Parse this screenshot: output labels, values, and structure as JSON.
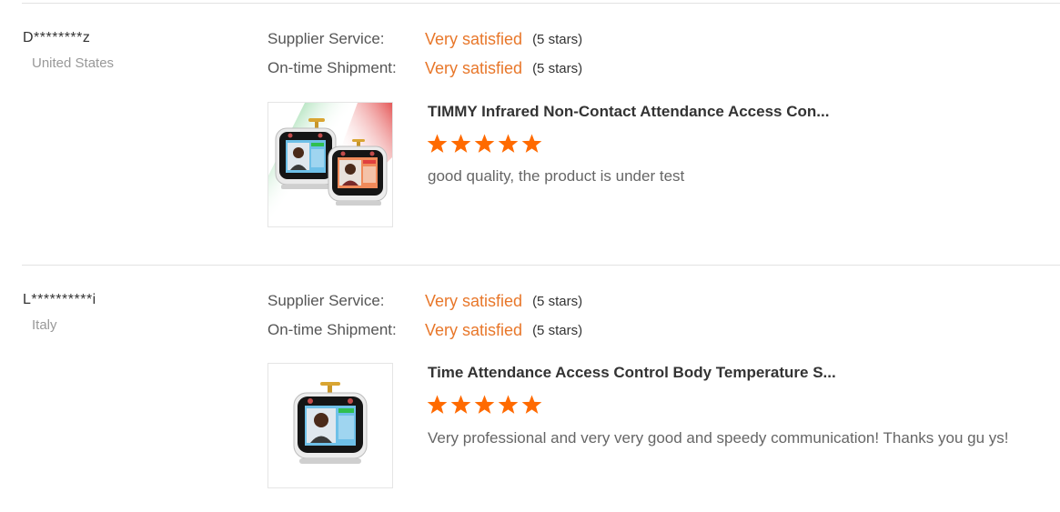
{
  "reviews": [
    {
      "buyer_name": "D********z",
      "buyer_country": "United States",
      "supplier_service": {
        "label": "Supplier Service:",
        "value": "Very satisfied",
        "stars_text": "(5 stars)"
      },
      "ontime_shipment": {
        "label": "On-time Shipment:",
        "value": "Very satisfied",
        "stars_text": "(5 stars)"
      },
      "product_title": "TIMMY Infrared Non-Contact Attendance Access Con...",
      "rating": 5,
      "comment": "good quality, the product is under test"
    },
    {
      "buyer_name": "L**********i",
      "buyer_country": "Italy",
      "supplier_service": {
        "label": "Supplier Service:",
        "value": "Very satisfied",
        "stars_text": "(5 stars)"
      },
      "ontime_shipment": {
        "label": "On-time Shipment:",
        "value": "Very satisfied",
        "stars_text": "(5 stars)"
      },
      "product_title": "Time Attendance Access Control Body Temperature S...",
      "rating": 5,
      "comment": "Very professional and very very good and speedy communication! Thanks you gu ys!"
    }
  ],
  "colors": {
    "accent": "#e8772a",
    "star": "#ff6a00",
    "divider": "#e2e2e2"
  }
}
